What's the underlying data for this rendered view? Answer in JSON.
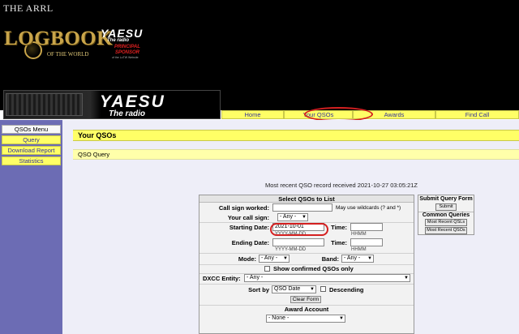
{
  "header": {
    "arrl": "THE ARRL",
    "logbook": "LOGBOOK",
    "of_the_world": "OF THE WORLD",
    "sponsor_brand": "YAESU",
    "sponsor_tagline": "The radio",
    "sponsor_line1": "PRINCIPAL",
    "sponsor_line2": "SPONSOR",
    "sponsor_note": "of the LoTW Website",
    "banner_brand": "YAESU",
    "banner_tagline": "The radio"
  },
  "nav": {
    "home": "Home",
    "your_qsos": "Your QSOs",
    "awards": "Awards",
    "find_call": "Find Call"
  },
  "sidebar": {
    "menu_title": "QSOs Menu",
    "items": [
      "Query",
      "Download Report",
      "Statistics"
    ]
  },
  "main": {
    "title": "Your QSOs",
    "subtitle": "QSO Query",
    "recent": "Most recent QSO record received 2021-10-27 03:05:21Z"
  },
  "form": {
    "section_title": "Select QSOs to List",
    "call_sign_worked_label": "Call sign worked:",
    "call_sign_worked_value": "",
    "wildcard_hint": "May use wildcards (? and *)",
    "your_call_label": "Your call sign:",
    "your_call_value": "- Any -",
    "starting_date_label": "Starting Date:",
    "starting_date_value": "2021-10-01",
    "starting_time_label": "Time:",
    "starting_time_value": "",
    "date_hint": "YYYY-MM-DD",
    "time_hint": "HHMM",
    "ending_date_label": "Ending Date:",
    "ending_date_value": "",
    "ending_time_label": "Time:",
    "ending_time_value": "",
    "mode_label": "Mode:",
    "mode_value": "- Any -",
    "band_label": "Band:",
    "band_value": "- Any -",
    "confirmed_label": "Show confirmed QSOs only",
    "dxcc_label": "DXCC Entity:",
    "dxcc_value": "- Any -",
    "sort_label": "Sort by",
    "sort_value": "QSO Date",
    "descending_label": "Descending",
    "clear_button": "Clear Form",
    "award_section": "Award Account",
    "award_value": "- None -"
  },
  "query_panel": {
    "title": "Submit Query Form",
    "submit": "Submit",
    "common_title": "Common Queries",
    "recent_qsls": "Most Recent QSLs",
    "recent_qsos": "Most Recent QSOs"
  },
  "colors": {
    "nav_bg": "#ffff66",
    "sidebar_bg": "#6c6cb4",
    "highlight": "#d42020"
  }
}
